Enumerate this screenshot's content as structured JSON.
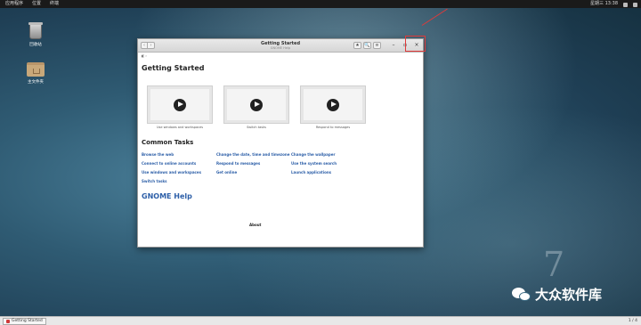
{
  "topbar": {
    "menu": [
      "应用程序",
      "位置",
      "终端"
    ],
    "clock": "星期三 13:38"
  },
  "desktop": {
    "icons": [
      {
        "label": "回收站",
        "icon": "trash-icon"
      },
      {
        "label": "主文件夹",
        "icon": "home-folder-icon"
      }
    ]
  },
  "window": {
    "title": "Getting Started",
    "subtitle": "GNOME Help",
    "breadcrumb": "◧ ›",
    "back_label": "‹",
    "forward_label": "›",
    "tools": [
      "★",
      "🔍",
      "≡"
    ],
    "controls": {
      "minimize": "–",
      "maximize": "▫",
      "close": "×"
    },
    "heading": "Getting Started",
    "videos": [
      {
        "caption": "Use windows and workspaces"
      },
      {
        "caption": "Switch tasks"
      },
      {
        "caption": "Respond to messages"
      }
    ],
    "common_tasks_title": "Common Tasks",
    "links": [
      "Browse the web",
      "Change the date, time and timezone",
      "Change the wallpaper",
      "Connect to online accounts",
      "Respond to messages",
      "Use the system search",
      "Use windows and workspaces",
      "Get online",
      "Launch applications",
      "Switch tasks"
    ],
    "help_title": "GNOME Help",
    "about": "About"
  },
  "watermark": {
    "big_number": "7",
    "text": "大众软件库"
  },
  "bottombar": {
    "task_label": "Getting Started",
    "pager": "1 / 4"
  },
  "colors": {
    "link": "#2d5fa8",
    "highlight": "#e03a3a"
  }
}
